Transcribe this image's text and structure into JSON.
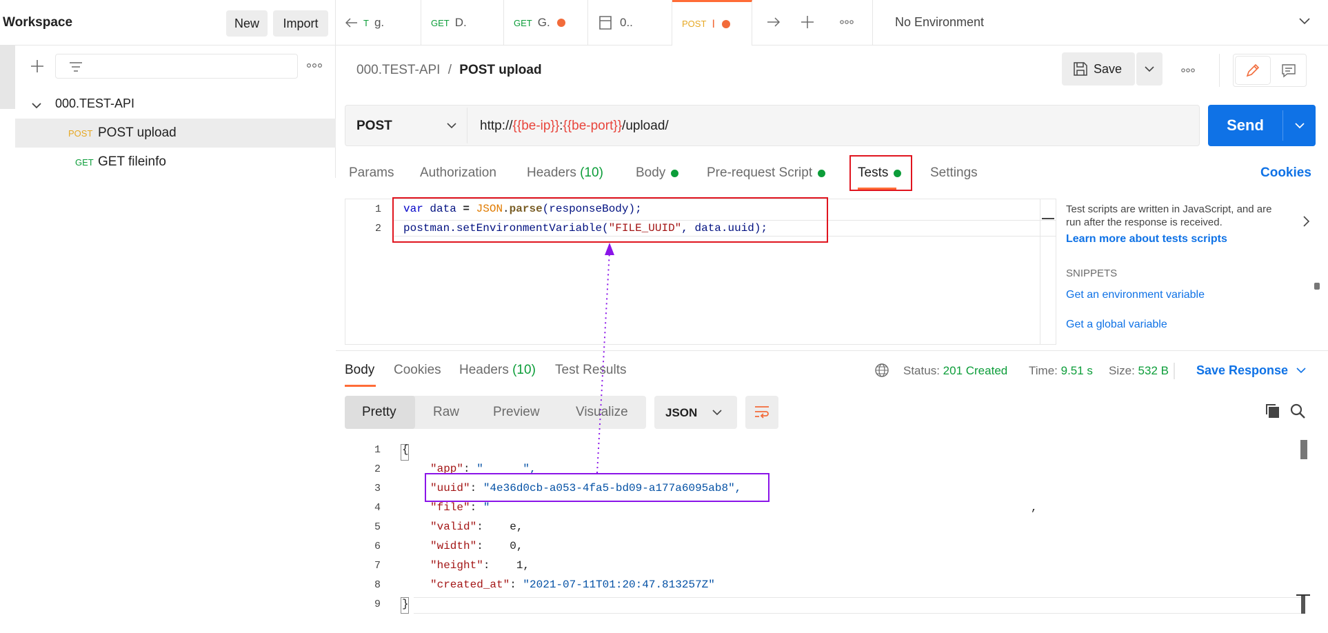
{
  "sidebar": {
    "title": "Workspace",
    "new_label": "New",
    "import_label": "Import",
    "collection": "000.TEST-API",
    "requests": [
      {
        "method": "POST",
        "name": "POST upload"
      },
      {
        "method": "GET",
        "name": "GET fileinfo"
      }
    ]
  },
  "tabs": [
    {
      "method": "",
      "label": "g."
    },
    {
      "method": "GET",
      "label": "D."
    },
    {
      "method": "GET",
      "label": "G."
    },
    {
      "method": "",
      "label": "0.."
    },
    {
      "method": "POST",
      "label": "I"
    }
  ],
  "environment": "No Environment",
  "request": {
    "collection": "000.TEST-API",
    "separator": "/",
    "name": "POST upload",
    "save_label": "Save",
    "method": "POST",
    "url_prefix": "http://",
    "url_var1": "{{be-ip}}",
    "url_colon": ":",
    "url_var2": "{{be-port}}",
    "url_suffix": "/upload/",
    "send_label": "Send",
    "cookies_label": "Cookies",
    "tabs": {
      "params": "Params",
      "authorization": "Authorization",
      "headers": "Headers",
      "headers_count": "(10)",
      "body": "Body",
      "prerequest": "Pre-request Script",
      "tests": "Tests",
      "settings": "Settings"
    }
  },
  "script": {
    "line_numbers": [
      "1",
      "2"
    ],
    "line1": {
      "kw": "var",
      "v1": " data ",
      "eq": "=",
      "obj": " JSON",
      "dot": ".",
      "fn": "parse",
      "rest": "(responseBody);"
    },
    "line2": {
      "pre": "postman.setEnvironmentVariable(",
      "str": "\"FILE_UUID\"",
      "rest": ", data.uuid);"
    }
  },
  "help": {
    "text": "Test scripts are written in JavaScript, and are run after the response is received.",
    "learn_more": "Learn more about tests scripts",
    "snippets_label": "SNIPPETS",
    "snippets": [
      "Get an environment variable",
      "Get a global variable"
    ]
  },
  "response": {
    "tabs": {
      "body": "Body",
      "cookies": "Cookies",
      "headers": "Headers",
      "headers_count": "(10)",
      "test_results": "Test Results"
    },
    "status_label": "Status:",
    "status_value": "201 Created",
    "time_label": "Time:",
    "time_value": "9.51 s",
    "size_label": "Size:",
    "size_value": "532 B",
    "save_response": "Save Response",
    "formats": [
      "Pretty",
      "Raw",
      "Preview",
      "Visualize"
    ],
    "language": "JSON",
    "json_lines": [
      {
        "n": "1",
        "key": "",
        "sep": "",
        "val": "{"
      },
      {
        "n": "2",
        "key": "\"app\"",
        "sep": ": ",
        "val": "\"      \","
      },
      {
        "n": "3",
        "key": "\"uuid\"",
        "sep": ": ",
        "val": "\"4e36d0cb-a053-4fa5-bd09-a177a6095ab8\","
      },
      {
        "n": "4",
        "key": "\"file\"",
        "sep": ": ",
        "val": "\""
      },
      {
        "n": "5",
        "key": "\"valid\"",
        "sep": ":    ",
        "val": "e,"
      },
      {
        "n": "6",
        "key": "\"width\"",
        "sep": ":    ",
        "val": "0,"
      },
      {
        "n": "7",
        "key": "\"height\"",
        "sep": ":    ",
        "val": "1,"
      },
      {
        "n": "8",
        "key": "\"created_at\"",
        "sep": ": ",
        "val": "\"2021-07-11T01:20:47.813257Z\""
      },
      {
        "n": "9",
        "key": "",
        "sep": "",
        "val": "}"
      }
    ],
    "stray_comma": ","
  },
  "colors": {
    "accent": "#ff6c37",
    "send_blue": "#0f72e6",
    "status_green": "#0c9d39",
    "highlight_red": "#e0141e",
    "highlight_purple": "#8a14e8"
  }
}
